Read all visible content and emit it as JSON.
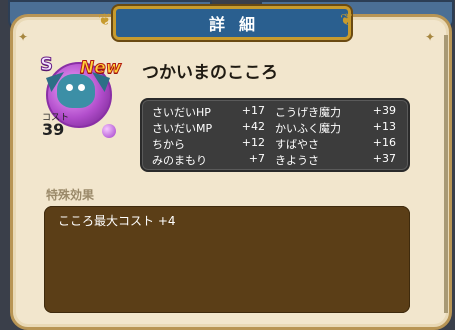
{
  "header": {
    "title": "詳細"
  },
  "monster": {
    "name": "つかいまのこころ",
    "rank": "S",
    "badge": "New",
    "cost_label": "コスト",
    "cost_value": "39"
  },
  "stats": [
    {
      "left_label": "さいだいHP",
      "left_value": "+17",
      "right_label": "こうげき魔力",
      "right_value": "+39"
    },
    {
      "left_label": "さいだいMP",
      "left_value": "+42",
      "right_label": "かいふく魔力",
      "right_value": "+13"
    },
    {
      "left_label": "ちから",
      "left_value": "+12",
      "right_label": "すばやさ",
      "right_value": "+16"
    },
    {
      "left_label": "みのまもり",
      "left_value": "+7",
      "right_label": "きようさ",
      "right_value": "+37"
    }
  ],
  "special": {
    "title": "特殊効果",
    "text": "こころ最大コスト +4"
  },
  "colors": {
    "panel": "#f2e6cd",
    "banner": "#2a5f8f",
    "stats_bg": "#3c3c3c",
    "effect_bg": "#5b3e17"
  }
}
